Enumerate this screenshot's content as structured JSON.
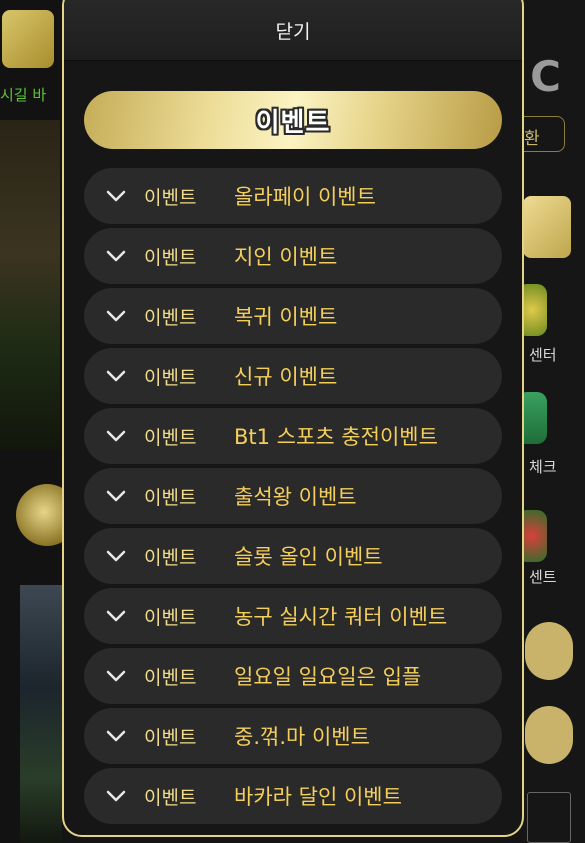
{
  "background": {
    "left_text": "시길 바",
    "right_switch": "환",
    "right_labels": [
      "센터",
      "체크",
      "센트"
    ]
  },
  "modal": {
    "close_label": "닫기",
    "banner_label": "이벤트",
    "items": [
      {
        "tag": "이벤트",
        "title": "올라페이 이벤트"
      },
      {
        "tag": "이벤트",
        "title": "지인 이벤트"
      },
      {
        "tag": "이벤트",
        "title": "복귀 이벤트"
      },
      {
        "tag": "이벤트",
        "title": "신규 이벤트"
      },
      {
        "tag": "이벤트",
        "title": "Bt1 스포츠 충전이벤트"
      },
      {
        "tag": "이벤트",
        "title": "출석왕 이벤트"
      },
      {
        "tag": "이벤트",
        "title": "슬롯 올인 이벤트"
      },
      {
        "tag": "이벤트",
        "title": "농구 실시간 쿼터 이벤트"
      },
      {
        "tag": "이벤트",
        "title": "일요일 일요일은 입플"
      },
      {
        "tag": "이벤트",
        "title": "중.꺾.마 이벤트"
      },
      {
        "tag": "이벤트",
        "title": "바카라 달인 이벤트"
      }
    ]
  },
  "colors": {
    "modal_border": "#e3d487",
    "tag_text": "#f1dd8c",
    "title_text": "#f5cf5b",
    "item_bg": "#2a2a2a"
  },
  "icons": {
    "item_expand": "chevron-down-icon"
  }
}
